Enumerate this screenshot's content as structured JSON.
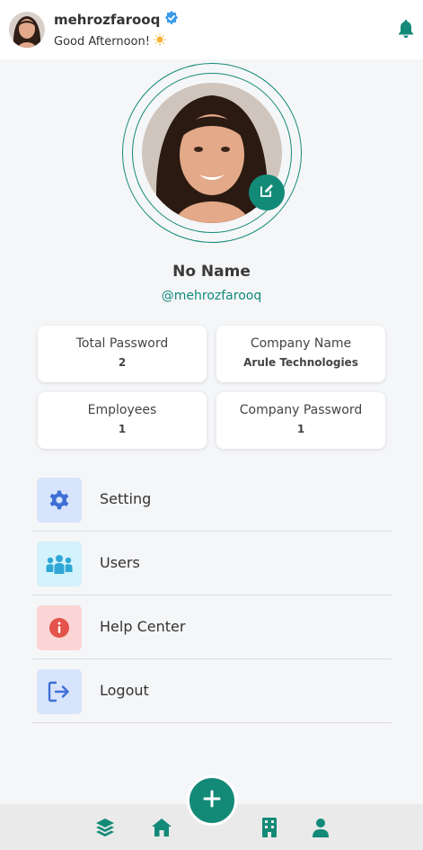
{
  "header": {
    "username": "mehrozfarooq",
    "greeting": "Good Afternoon!",
    "verified_icon": "verified-badge-icon",
    "greeting_icon": "sun-icon",
    "notification_icon": "bell-icon"
  },
  "profile": {
    "name": "No Name",
    "handle": "@mehrozfarooq",
    "edit_icon": "edit-icon"
  },
  "stats": [
    {
      "label": "Total Password",
      "value": "2"
    },
    {
      "label": "Company Name",
      "value": "Arule Technologies"
    },
    {
      "label": "Employees",
      "value": "1"
    },
    {
      "label": "Company Password",
      "value": "1"
    }
  ],
  "menu": [
    {
      "label": "Setting",
      "icon": "gear-icon",
      "bg": "#d8e4fb",
      "color": "#3d6fd6"
    },
    {
      "label": "Users",
      "icon": "users-icon",
      "bg": "#d3f2fb",
      "color": "#2fa7d6"
    },
    {
      "label": "Help Center",
      "icon": "info-icon",
      "bg": "#fbd5d5",
      "color": "#e4534b"
    },
    {
      "label": "Logout",
      "icon": "logout-icon",
      "bg": "#d8e4fb",
      "color": "#3d6fd6"
    }
  ],
  "bottom_nav": {
    "items": [
      "layers-icon",
      "home-icon",
      "add-icon",
      "building-icon",
      "user-icon"
    ]
  },
  "colors": {
    "accent": "#138a78",
    "background": "#f5f6f8"
  }
}
